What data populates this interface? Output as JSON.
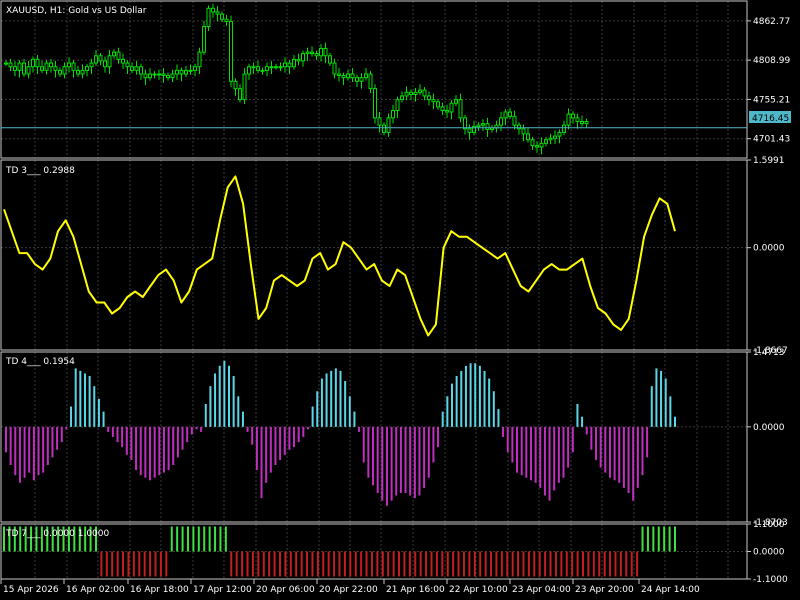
{
  "window": {
    "symbol_title": "XAUUSD, H1:  Gold vs US Dollar",
    "current_price": "4716.45"
  },
  "colors": {
    "background": "#000000",
    "grid": "#3a3a3a",
    "candle": "#00e000",
    "price_line": "#4fb8c8",
    "td3_line": "#ffff00",
    "td4_pos": "#5bd6e8",
    "td4_neg": "#c030c0",
    "td7_pos": "#40e040",
    "td7_neg": "#c02020",
    "text": "#ffffff"
  },
  "chart_data": [
    {
      "type": "candlestick",
      "name": "XAUUSD, H1",
      "title": "XAUUSD, H1:  Gold vs US Dollar",
      "y_ticks": [
        "4862.77",
        "4808.99",
        "4755.21",
        "4701.43"
      ],
      "ylim": [
        4675,
        4890
      ],
      "current_price": 4716.45,
      "close_path": [
        4805,
        4800,
        4795,
        4805,
        4790,
        4800,
        4810,
        4800,
        4795,
        4805,
        4800,
        4795,
        4790,
        4800,
        4805,
        4795,
        4790,
        4795,
        4800,
        4805,
        4815,
        4808,
        4800,
        4815,
        4820,
        4810,
        4805,
        4800,
        4795,
        4800,
        4790,
        4785,
        4790,
        4790,
        4790,
        4788,
        4785,
        4790,
        4795,
        4790,
        4795,
        4795,
        4800,
        4820,
        4855,
        4880,
        4875,
        4872,
        4865,
        4862,
        4780,
        4770,
        4755,
        4790,
        4800,
        4800,
        4795,
        4795,
        4800,
        4800,
        4800,
        4800,
        4805,
        4800,
        4810,
        4808,
        4818,
        4820,
        4818,
        4815,
        4825,
        4815,
        4805,
        4790,
        4788,
        4785,
        4790,
        4785,
        4780,
        4785,
        4790,
        4770,
        4730,
        4720,
        4710,
        4730,
        4740,
        4755,
        4760,
        4765,
        4762,
        4765,
        4768,
        4760,
        4755,
        4752,
        4745,
        4740,
        4738,
        4750,
        4755,
        4730,
        4715,
        4710,
        4718,
        4720,
        4722,
        4714,
        4716,
        4720,
        4730,
        4738,
        4732,
        4720,
        4715,
        4708,
        4700,
        4692,
        4690,
        4695,
        4700,
        4702,
        4705,
        4710,
        4720,
        4735,
        4730,
        4725,
        4722,
        4725
      ]
    },
    {
      "type": "line",
      "name": "TD 3",
      "value_label": "0.2988",
      "y_ticks": [
        "1.5991",
        "0.0000",
        "-1.8667"
      ],
      "ylim": [
        -1.8667,
        1.5991
      ],
      "series": [
        {
          "values": [
            0.7,
            0.3,
            -0.1,
            -0.1,
            -0.3,
            -0.4,
            -0.2,
            0.3,
            0.5,
            0.2,
            -0.3,
            -0.8,
            -1.0,
            -1.0,
            -1.2,
            -1.1,
            -0.9,
            -0.8,
            -0.9,
            -0.7,
            -0.5,
            -0.4,
            -0.6,
            -1.0,
            -0.8,
            -0.4,
            -0.3,
            -0.2,
            0.5,
            1.1,
            1.3,
            0.8,
            -0.3,
            -1.3,
            -1.1,
            -0.6,
            -0.5,
            -0.6,
            -0.7,
            -0.6,
            -0.2,
            -0.1,
            -0.4,
            -0.3,
            0.1,
            0.0,
            -0.2,
            -0.4,
            -0.3,
            -0.6,
            -0.7,
            -0.4,
            -0.5,
            -0.9,
            -1.3,
            -1.6,
            -1.4,
            0.0,
            0.3,
            0.2,
            0.2,
            0.1,
            0.0,
            -0.1,
            -0.2,
            -0.1,
            -0.4,
            -0.7,
            -0.8,
            -0.6,
            -0.4,
            -0.3,
            -0.4,
            -0.4,
            -0.3,
            -0.2,
            -0.7,
            -1.1,
            -1.2,
            -1.4,
            -1.5,
            -1.3,
            -0.6,
            0.2,
            0.6,
            0.9,
            0.8,
            0.3
          ]
        }
      ]
    },
    {
      "type": "bar",
      "name": "TD 4",
      "value_label": "0.1954",
      "y_ticks": [
        "1.4713",
        "0.0000",
        "-1.8703"
      ],
      "ylim": [
        -1.8703,
        1.4713
      ],
      "series": [
        {
          "values": [
            -0.5,
            -0.75,
            -0.95,
            -1.1,
            -1.0,
            -0.9,
            -1.05,
            -0.95,
            -0.9,
            -0.75,
            -0.6,
            -0.45,
            -0.3,
            -0.05,
            0.4,
            1.15,
            1.1,
            1.05,
            1.0,
            0.8,
            0.55,
            0.3,
            -0.1,
            -0.2,
            -0.3,
            -0.4,
            -0.55,
            -0.65,
            -0.85,
            -0.95,
            -1.0,
            -1.05,
            -1.0,
            -0.95,
            -0.9,
            -0.85,
            -0.75,
            -0.6,
            -0.45,
            -0.3,
            -0.15,
            -0.05,
            -0.1,
            0.45,
            0.8,
            1.05,
            1.2,
            1.3,
            1.2,
            1.0,
            0.6,
            0.3,
            -0.1,
            -0.35,
            -0.85,
            -1.4,
            -1.1,
            -0.9,
            -0.75,
            -0.65,
            -0.55,
            -0.45,
            -0.4,
            -0.3,
            -0.2,
            -0.05,
            0.4,
            0.7,
            0.95,
            1.05,
            1.1,
            1.15,
            1.1,
            0.9,
            0.6,
            0.3,
            -0.1,
            -0.7,
            -1.0,
            -1.15,
            -1.3,
            -1.45,
            -1.55,
            -1.45,
            -1.35,
            -1.3,
            -1.3,
            -1.35,
            -1.4,
            -1.35,
            -1.2,
            -1.0,
            -0.7,
            -0.4,
            0.3,
            0.6,
            0.85,
            1.0,
            1.1,
            1.2,
            1.25,
            1.25,
            1.2,
            1.1,
            0.95,
            0.7,
            0.35,
            -0.2,
            -0.5,
            -0.7,
            -0.9,
            -0.95,
            -1.0,
            -1.05,
            -1.1,
            -1.2,
            -1.35,
            -1.45,
            -1.25,
            -1.1,
            -1.0,
            -0.8,
            -0.5,
            0.45,
            0.2,
            -0.15,
            -0.45,
            -0.65,
            -0.8,
            -0.9,
            -1.0,
            -1.05,
            -1.1,
            -1.2,
            -1.3,
            -1.45,
            -1.2,
            -0.95,
            -0.6,
            0.8,
            1.15,
            1.1,
            0.95,
            0.6,
            0.2
          ]
        }
      ]
    },
    {
      "type": "bar",
      "name": "TD 7",
      "value_label": "0.0000 1.0000",
      "y_ticks": [
        "1.1000",
        "0.0000",
        "-1.1000"
      ],
      "ylim": [
        -1.1,
        1.1
      ],
      "series": [
        {
          "name": "segments",
          "values": [
            1,
            -1,
            1,
            -1,
            1
          ],
          "lengths": [
            18,
            13,
            11,
            76,
            7
          ]
        }
      ]
    }
  ],
  "x_ticks": [
    "15 Apr 2026",
    "16 Apr 02:00",
    "16 Apr 18:00",
    "17 Apr 12:00",
    "20 Apr 06:00",
    "20 Apr 22:00",
    "21 Apr 16:00",
    "22 Apr 10:00",
    "23 Apr 04:00",
    "23 Apr 20:00",
    "24 Apr 14:00"
  ]
}
